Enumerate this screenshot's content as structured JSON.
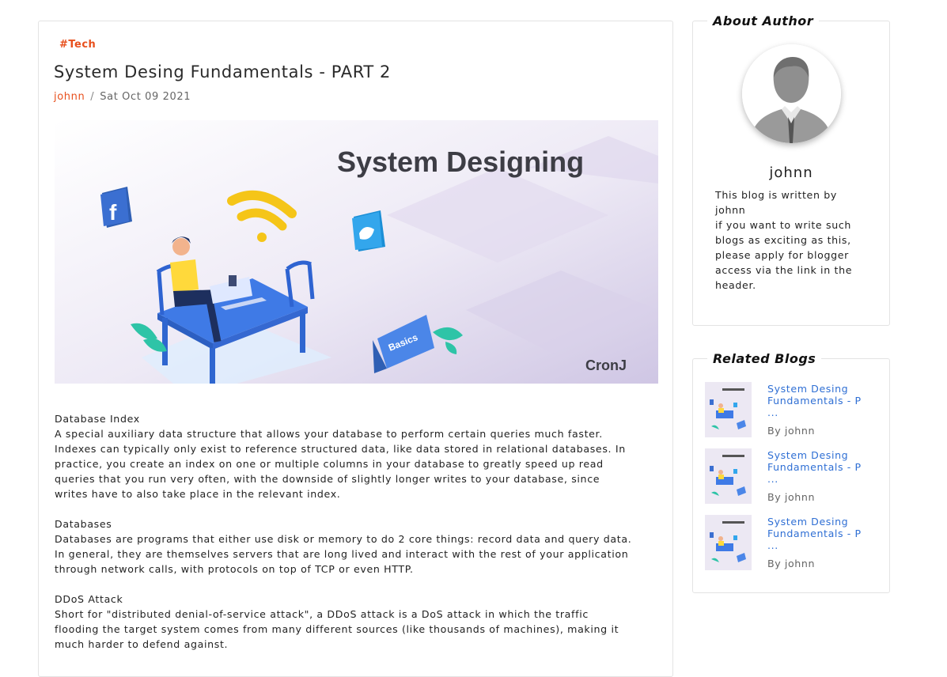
{
  "post": {
    "tag": "#Tech",
    "title": "System Desing Fundamentals - PART 2",
    "author": "johnn",
    "separator": "/",
    "date": "Sat Oct 09 2021",
    "hero": {
      "headline": "System Designing",
      "badge": "Basics",
      "brand": "CronJ"
    },
    "sections": [
      {
        "heading": "Database Index",
        "lines": [
          "A special auxiliary data structure that allows your database to perform certain queries much faster.",
          "Indexes can typically only exist to reference structured data, like data stored in relational databases. In",
          "practice, you create an index on one or multiple columns in your database to greatly speed up read",
          "queries that you run very often, with the downside of slightly longer writes to your database, since",
          "writes have to also take place in the relevant index."
        ]
      },
      {
        "heading": "Databases",
        "lines": [
          "Databases are programs that either use disk or memory to do 2 core things: record data and query data.",
          "In general, they are themselves servers that are long lived and interact with the rest of your application",
          "through network calls, with protocols on top of TCP or even HTTP."
        ]
      },
      {
        "heading": "DDoS Attack",
        "lines": [
          "Short for \"distributed denial-of-service attack\", a DDoS attack is a DoS attack in which the traffic",
          "flooding the target system comes from many different sources (like thousands of machines), making it",
          "much harder to defend against."
        ]
      }
    ]
  },
  "about": {
    "heading": "About Author",
    "name": "johnn",
    "bio_lines": [
      "This blog is written by",
      "johnn",
      "if you want to write such",
      "blogs as exciting as this,",
      "please apply for blogger",
      "access via the link in the",
      "header."
    ]
  },
  "related": {
    "heading": "Related Blogs",
    "items": [
      {
        "title_line1": "System Desing",
        "title_line2": "Fundamentals - P",
        "ellipsis": "...",
        "by": "By johnn"
      },
      {
        "title_line1": "System Desing",
        "title_line2": "Fundamentals - P",
        "ellipsis": "...",
        "by": "By johnn"
      },
      {
        "title_line1": "System Desing",
        "title_line2": "Fundamentals - P",
        "ellipsis": "...",
        "by": "By johnn"
      }
    ]
  },
  "colors": {
    "accent": "#e8501d",
    "link": "#2f6fd4",
    "border": "#e3e3e3"
  },
  "icons": [
    "facebook-icon",
    "twitter-icon",
    "wifi-icon",
    "laptop-icon"
  ]
}
